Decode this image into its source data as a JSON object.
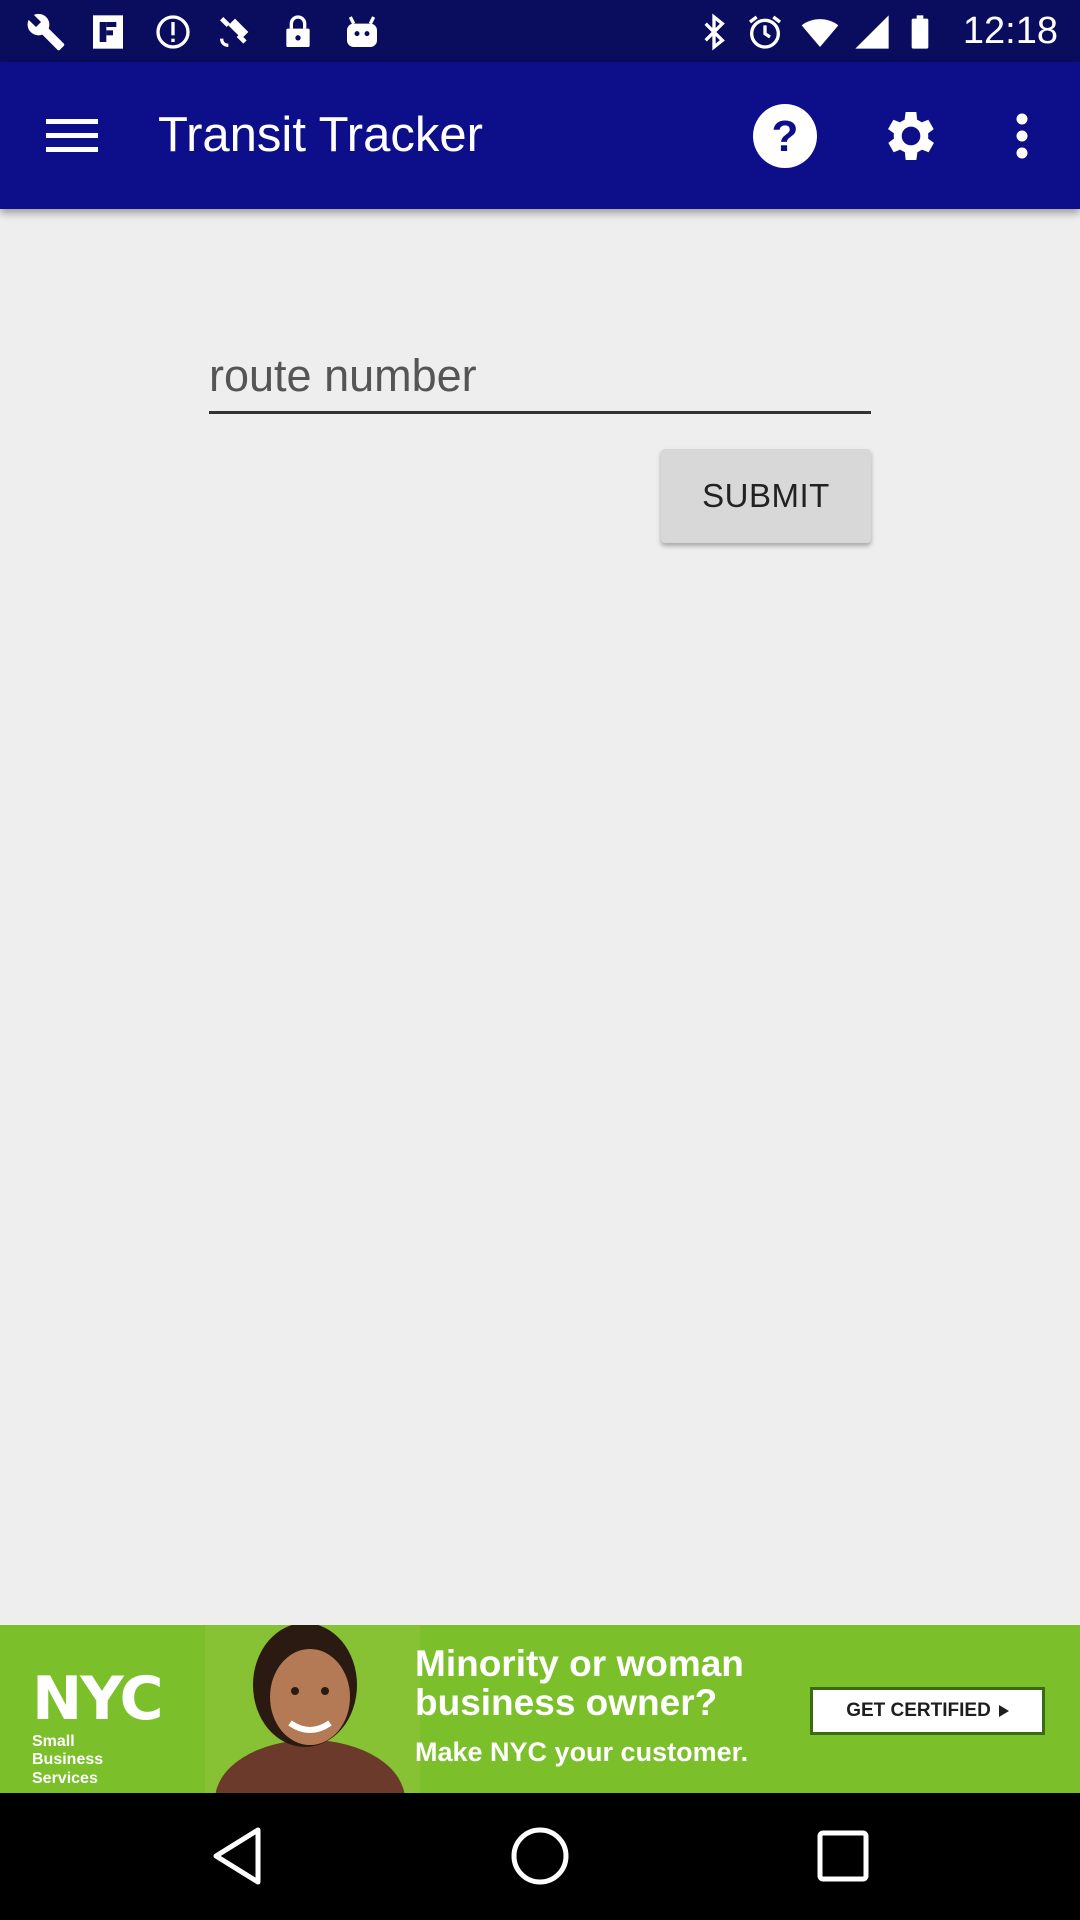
{
  "status_bar": {
    "time": "12:18",
    "left_icons": [
      "wrench-icon",
      "fake-gps-icon",
      "data-saver-icon",
      "satellite-icon",
      "lock-icon",
      "android-icon"
    ],
    "right_icons": [
      "bluetooth-icon",
      "alarm-icon",
      "wifi-icon",
      "signal-icon",
      "battery-icon"
    ]
  },
  "app_bar": {
    "title": "Transit Tracker",
    "background": "#0d0f8a",
    "actions": [
      "menu-icon",
      "help-icon",
      "settings-icon",
      "overflow-icon"
    ]
  },
  "form": {
    "route_placeholder": "route number",
    "route_value": "",
    "submit_label": "SUBMIT"
  },
  "ad": {
    "logo_text": "NYC",
    "logo_sub": "Small Business Services",
    "headline_1": "Minority or woman",
    "headline_2": "business owner?",
    "subline": "Make NYC your customer.",
    "cta": "GET CERTIFIED",
    "background": "#7bbf2a"
  },
  "nav_bar": {
    "buttons": [
      "back-icon",
      "home-icon",
      "recents-icon"
    ]
  }
}
